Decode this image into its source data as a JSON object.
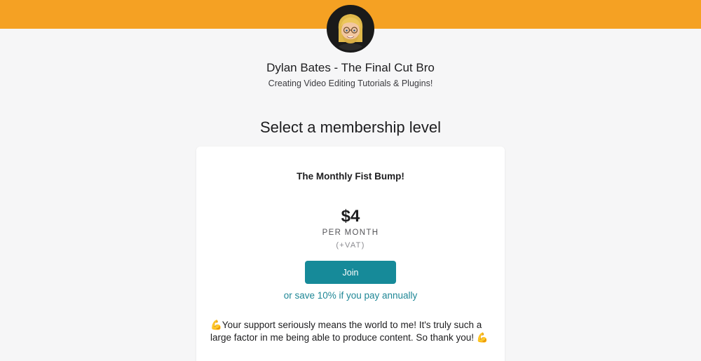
{
  "theme": {
    "banner_color": "#f5a123",
    "accent_color": "#168a99",
    "link_color": "#1f8796"
  },
  "creator": {
    "name": "Dylan Bates - The Final Cut Bro",
    "tagline": "Creating Video Editing Tutorials & Plugins!",
    "avatar_icon": "avatar-cartoon-blonde-man"
  },
  "membership": {
    "section_title": "Select a membership level",
    "tier": {
      "name": "The Monthly Fist Bump!",
      "price": "$4",
      "period": "PER MONTH",
      "tax_note": "(+VAT)",
      "join_label": "Join",
      "annual_offer": "or save 10% if you pay annually",
      "description": "💪Your support seriously means the world to me! It's truly such a large factor in me being able to produce content. So thank you! 💪"
    }
  }
}
